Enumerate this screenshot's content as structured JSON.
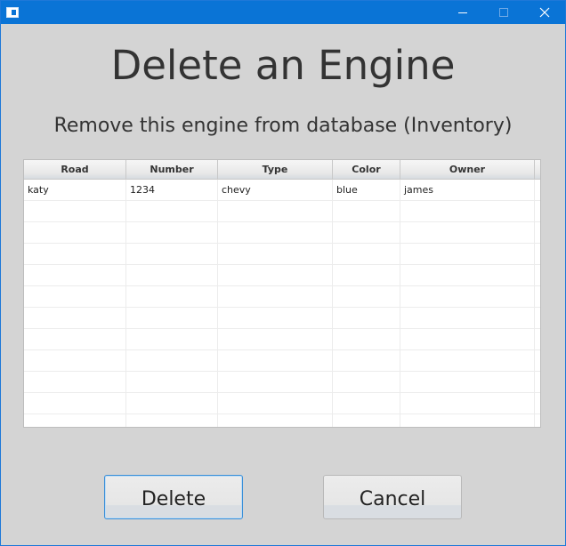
{
  "window": {
    "close_glyph": "close"
  },
  "dialog": {
    "title": "Delete an Engine",
    "subtitle": "Remove this engine from database (Inventory)"
  },
  "table": {
    "columns": [
      "Road",
      "Number",
      "Type",
      "Color",
      "Owner"
    ],
    "rows": [
      [
        "katy",
        "1234",
        "chevy",
        "blue",
        "james"
      ]
    ],
    "empty_row_count": 10
  },
  "buttons": {
    "delete_label": "Delete",
    "cancel_label": "Cancel"
  },
  "colors": {
    "titlebar": "#0a74d6",
    "dialog_background": "#d4d4d4",
    "focus_border": "#3a8fd8"
  },
  "icons": {
    "app": "app-icon",
    "minimize": "minimize-icon",
    "maximize": "maximize-icon",
    "close": "close-icon"
  }
}
